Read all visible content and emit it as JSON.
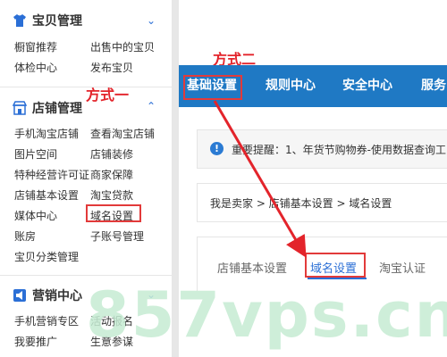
{
  "sidebar": {
    "sections": [
      {
        "title": "宝贝管理",
        "icon": "shirt-icon",
        "items": [
          "橱窗推荐",
          "出售中的宝贝",
          "体检中心",
          "发布宝贝"
        ]
      },
      {
        "title": "店铺管理",
        "icon": "shop-icon",
        "items": [
          "手机淘宝店铺",
          "查看淘宝店铺",
          "图片空间",
          "店铺装修",
          "特种经营许可证",
          "商家保障",
          "店铺基本设置",
          "淘宝贷款",
          "媒体中心",
          "域名设置",
          "账房",
          "子账号管理",
          "宝贝分类管理"
        ]
      },
      {
        "title": "营销中心",
        "icon": "megaphone-icon",
        "items": [
          "手机营销专区",
          "活动报名",
          "我要推广",
          "生意参谋"
        ]
      }
    ]
  },
  "annotations": {
    "method1": "方式一",
    "method2": "方式二"
  },
  "topnav": {
    "tabs": [
      "基础设置",
      "规则中心",
      "安全中心",
      "服务"
    ]
  },
  "notice": {
    "icon": "info-icon",
    "text": "重要提醒：1、年货节购物券-使用数据查询工..."
  },
  "breadcrumb": {
    "text": "我是卖家 > 店铺基本设置 > 域名设置"
  },
  "subtabs": {
    "items": [
      "店铺基本设置",
      "域名设置",
      "淘宝认证"
    ],
    "active": "域名设置"
  },
  "watermark": "857vps.cn",
  "colors": {
    "accent": "#1f79c4",
    "annotation": "#e3242b",
    "link": "#2b6fd6"
  }
}
